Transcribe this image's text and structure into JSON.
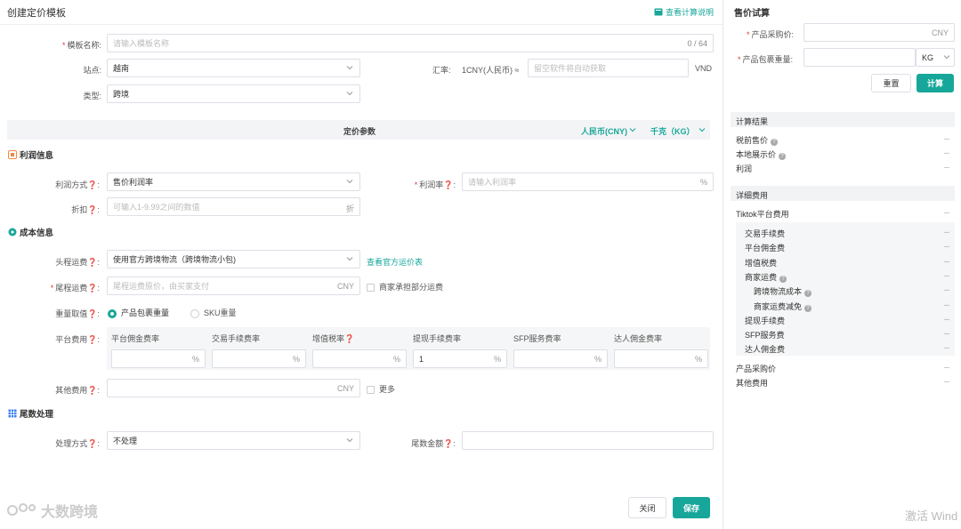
{
  "header": {
    "title": "创建定价模板",
    "help_link": "查看计算说明"
  },
  "form": {
    "template_name": {
      "label": "模板名称:",
      "placeholder": "请输入模板名称",
      "counter": "0 / 64"
    },
    "site": {
      "label": "站点:",
      "value": "越南"
    },
    "rate": {
      "label": "汇率:",
      "prefix": "1CNY(人民币) ≈",
      "placeholder": "留空软件将自动获取",
      "unit": "VND"
    },
    "type": {
      "label": "类型:",
      "value": "跨境"
    },
    "params_band": {
      "title": "定价参数",
      "currency": "人民币(CNY)",
      "weight_unit": "千克（KG）"
    },
    "profit_section": "利润信息",
    "profit_method": {
      "label": "利润方式",
      "value": "售价利润率"
    },
    "profit_rate": {
      "label": "利润率",
      "placeholder": "请输入利润率",
      "suffix": "%"
    },
    "discount": {
      "label": "折扣",
      "placeholder": "可输入1-9.99之间的数值",
      "suffix": "折"
    },
    "cost_section": "成本信息",
    "first_freight": {
      "label": "头程运费",
      "value": "使用官方跨境物流（跨境物流小包)",
      "link": "查看官方运价表"
    },
    "last_freight": {
      "label": "尾程运费",
      "placeholder": "尾程运费原价，由买家支付",
      "suffix": "CNY",
      "checkbox": "商家承担部分运费"
    },
    "weight": {
      "label": "重量取值",
      "option1": "产品包裹重量",
      "option2": "SKU重量"
    },
    "platform_fees": {
      "label": "平台费用",
      "headers": [
        "平台佣金费率",
        "交易手续费率",
        "增值税率",
        "提现手续费率",
        "SFP服务费率",
        "达人佣金费率"
      ],
      "values": [
        "",
        "",
        "",
        "1",
        "",
        ""
      ],
      "suffix": "%"
    },
    "other_fees": {
      "label": "其他费用",
      "suffix": "CNY",
      "checkbox": "更多"
    },
    "tail_section": "尾数处理",
    "tail_method": {
      "label": "处理方式",
      "value": "不处理"
    },
    "tail_amount": {
      "label": "尾数金额"
    }
  },
  "footer": {
    "close": "关闭",
    "save": "保存",
    "watermark": "大数跨境"
  },
  "side": {
    "title": "售价试算",
    "purchase": {
      "label": "产品采购价:",
      "suffix": "CNY"
    },
    "weight": {
      "label": "产品包裹重量:",
      "unit": "KG"
    },
    "reset": "重置",
    "calc": "计算",
    "result_title": "计算结果",
    "results": [
      {
        "label": "税前售价",
        "value": "--"
      },
      {
        "label": "本地展示价",
        "value": "--"
      },
      {
        "label": "利润",
        "value": "--"
      }
    ],
    "detail_title": "详细费用",
    "detail_top": {
      "label": "Tiktok平台费用",
      "value": "--"
    },
    "detail_items": [
      {
        "label": "交易手续费",
        "value": "--"
      },
      {
        "label": "平台佣金费",
        "value": "--"
      },
      {
        "label": "增值税费",
        "value": "--"
      },
      {
        "label": "商家运费",
        "value": "--"
      },
      {
        "label": "跨境物流成本",
        "value": "--"
      },
      {
        "label": "商家运费减免",
        "value": "--"
      },
      {
        "label": "提现手续费",
        "value": "--"
      },
      {
        "label": "SFP服务费",
        "value": "--"
      },
      {
        "label": "达人佣金费",
        "value": "--"
      }
    ],
    "detail_bottom": [
      {
        "label": "产品采购价",
        "value": "--"
      },
      {
        "label": "其他费用",
        "value": "--"
      }
    ],
    "activation": "激活 Wind"
  },
  "colors": {
    "accent": "#17a79a",
    "required": "#e4393c",
    "band": "#f3f4f6"
  }
}
